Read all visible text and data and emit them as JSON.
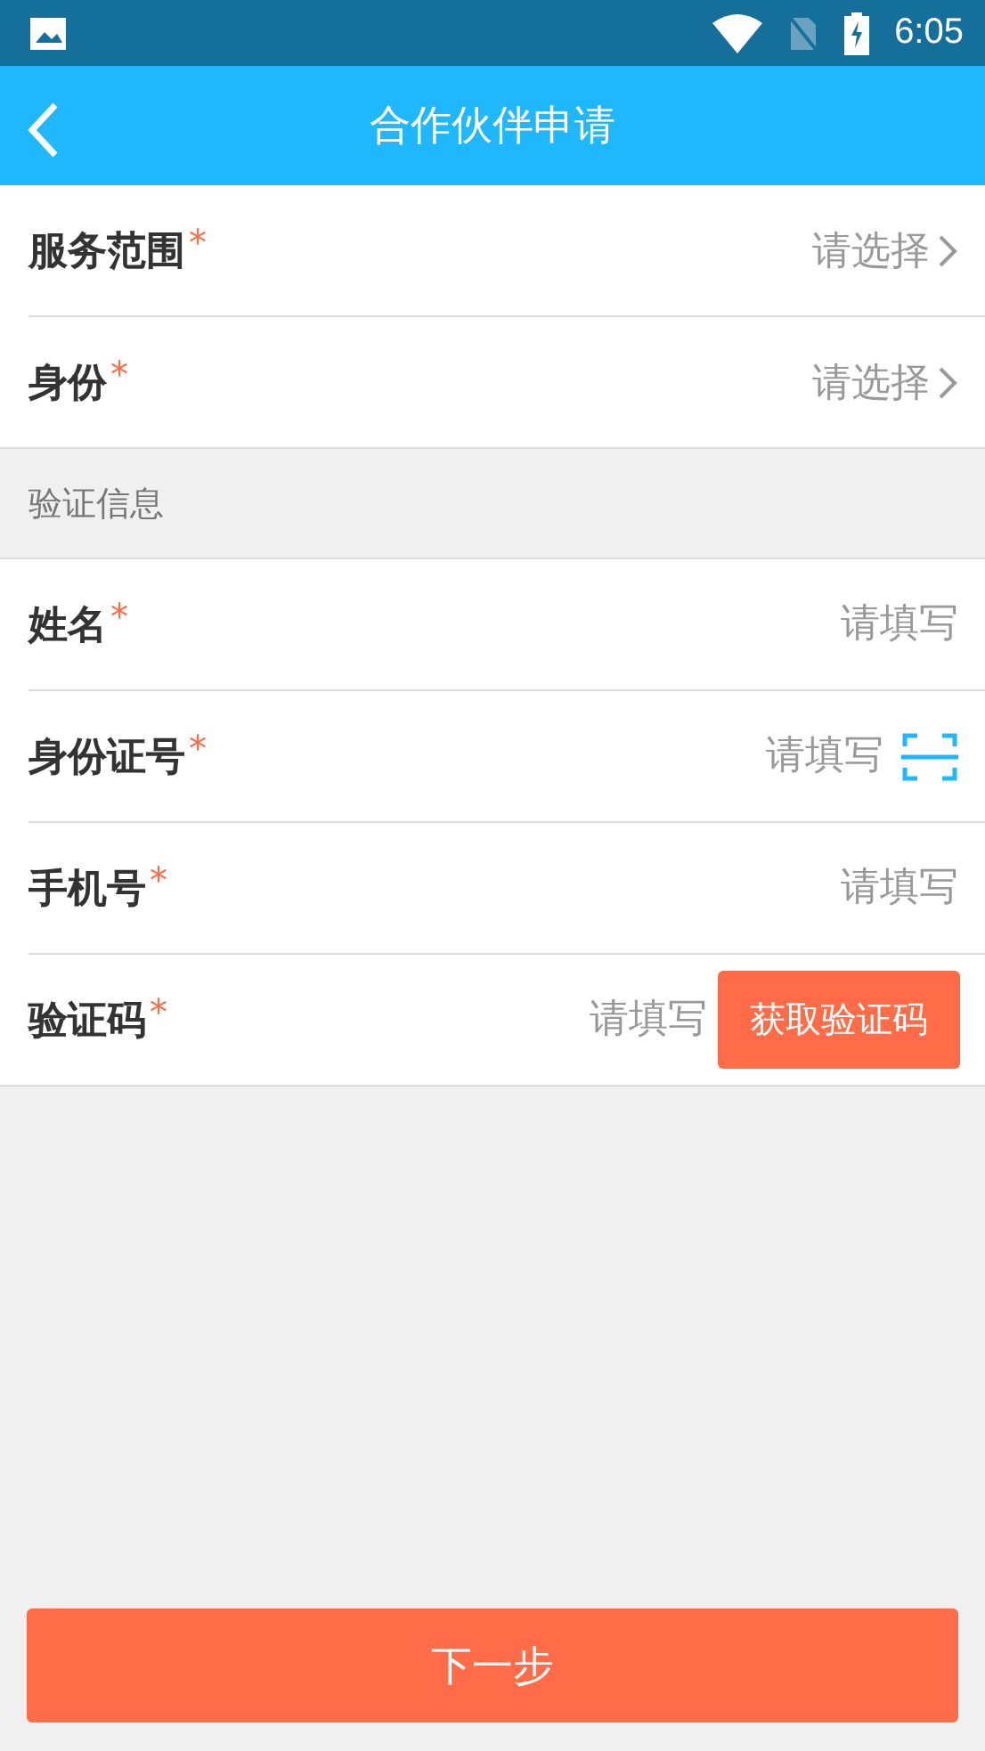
{
  "status_bar": {
    "time": "6:05"
  },
  "header": {
    "title": "合作伙伴申请"
  },
  "groups": [
    {
      "rows": [
        {
          "kind": "select",
          "label": "服务范围",
          "mark": "*",
          "placeholder": "请选择"
        },
        {
          "kind": "select",
          "label": "身份",
          "mark": "*",
          "placeholder": "请选择"
        }
      ]
    },
    {
      "title": "验证信息",
      "rows": [
        {
          "kind": "input",
          "label": "姓名",
          "mark": "*",
          "placeholder": "请填写"
        },
        {
          "kind": "scan",
          "label": "身份证号",
          "mark": "*",
          "placeholder": "请填写"
        },
        {
          "kind": "input",
          "label": "手机号",
          "mark": "*",
          "placeholder": "请填写"
        },
        {
          "kind": "code",
          "label": "验证码",
          "mark": "*",
          "placeholder": "请填写",
          "action": "获取验证码"
        }
      ]
    }
  ],
  "next_button": "下一步"
}
